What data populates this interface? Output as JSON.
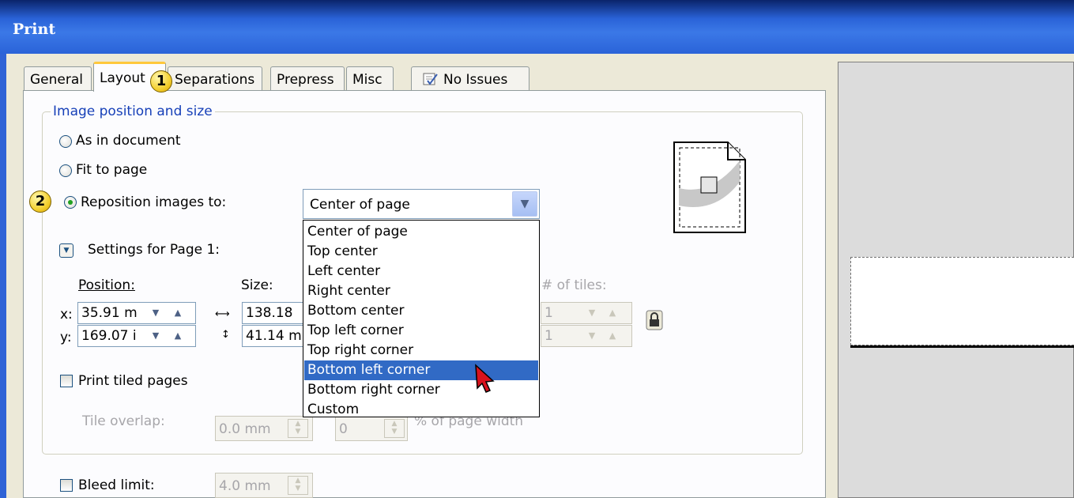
{
  "window": {
    "title": "Print"
  },
  "tabs": [
    {
      "label": "General"
    },
    {
      "label": "Layout"
    },
    {
      "label": "Separations"
    },
    {
      "label": "Prepress"
    },
    {
      "label": "Misc"
    },
    {
      "label": "No Issues"
    }
  ],
  "group": {
    "title": "Image position and size"
  },
  "options": {
    "as_in_document": "As in document",
    "fit_to_page": "Fit to page",
    "reposition": "Reposition images to:"
  },
  "reposition_combo": {
    "value": "Center of page",
    "options": [
      "Center of page",
      "Top center",
      "Left center",
      "Right center",
      "Bottom center",
      "Top left corner",
      "Top right corner",
      "Bottom left corner",
      "Bottom right corner",
      "Custom"
    ],
    "highlighted": "Bottom left corner"
  },
  "settings": {
    "label": "Settings for Page 1:"
  },
  "position": {
    "label": "Position:",
    "x_label": "x:",
    "y_label": "y:",
    "x_value": "35.91 m",
    "y_value": "169.07 i"
  },
  "size": {
    "label": "Size:",
    "w_value": "138.18",
    "h_value": "41.14 m"
  },
  "tiles": {
    "label": "# of tiles:",
    "x_value": "1",
    "y_value": "1"
  },
  "print_tiled": {
    "label": "Print tiled pages"
  },
  "tile_overlap": {
    "label": "Tile overlap:",
    "value": "0.0 mm",
    "percent_value": "0",
    "percent_label": "% of page width"
  },
  "bleed": {
    "label": "Bleed limit:",
    "value": "4.0 mm"
  },
  "callouts": {
    "one": "1",
    "two": "2"
  },
  "colors": {
    "titlebar": "#2a63d8",
    "selection": "#316ac5",
    "group_title": "#1740b8",
    "tab_highlight": "#ffc83c"
  }
}
